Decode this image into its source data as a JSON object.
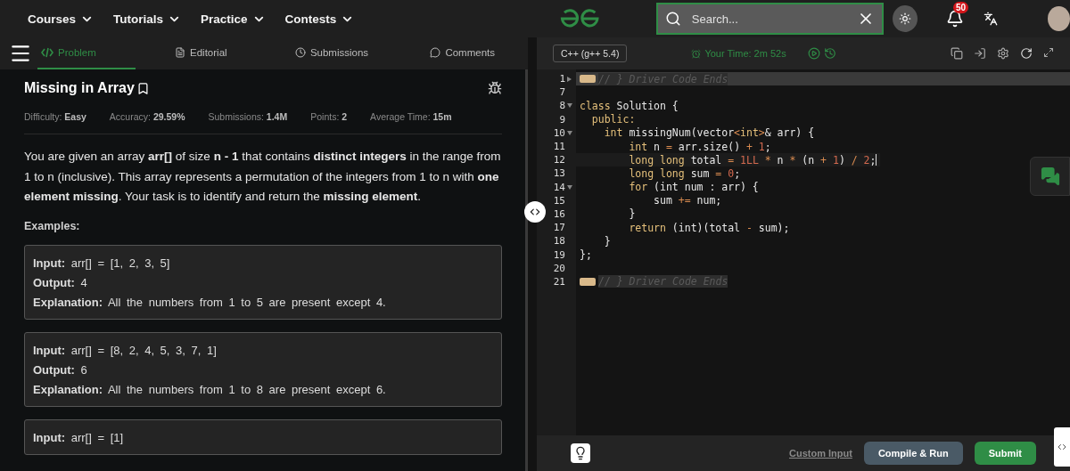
{
  "nav": {
    "menus": [
      "Courses",
      "Tutorials",
      "Practice",
      "Contests"
    ],
    "search": {
      "placeholder": "Search..."
    },
    "notifications": {
      "count": "50"
    }
  },
  "tabs": [
    {
      "label": "Problem",
      "selected": true
    },
    {
      "label": "Editorial",
      "selected": false
    },
    {
      "label": "Submissions",
      "selected": false
    },
    {
      "label": "Comments",
      "selected": false
    }
  ],
  "problem": {
    "title": "Missing in Array",
    "meta": [
      "Difficulty: **Easy**",
      "Accuracy: **29.59%**",
      "Submissions: **1.4M**",
      "Points: **2**",
      "Average Time: **15m**"
    ],
    "description": "You are given an array **arr[]** of size **n - 1** that contains **distinct integers** in the range from 1 to n (inclusive). This array represents a permutation of the integers from 1 to n with **one element missing**. Your task is to identify and return the **missing element**.",
    "examples_label": "Examples:",
    "examples": [
      [
        "**Input:** arr[] = [1, 2, 3, 5]",
        "**Output:** 4",
        "**Explanation:** All the numbers from 1 to 5 are present except 4."
      ],
      [
        "**Input:** arr[] = [8, 2, 4, 5, 3, 7, 1]",
        "**Output:** 6",
        "**Explanation:** All the numbers from 1 to 8 are present except 6."
      ],
      [
        "**Input:** arr[] = [1]"
      ]
    ]
  },
  "editor": {
    "language": "C++ (g++ 5.4)",
    "timer": "Your Time: 2m 52s",
    "lines": [
      {
        "number": "1",
        "kind": "collapsed",
        "highlighted": true,
        "cursor": false,
        "tokens": [
          {
            "kind": "folded",
            "t": "// } Driver Code Ends"
          }
        ]
      },
      {
        "number": "7",
        "kind": "plain",
        "highlighted": false,
        "cursor": false
      },
      {
        "number": "8",
        "kind": "expanded",
        "highlighted": false,
        "cursor": false,
        "tokens": [
          {
            "kind": "keyword",
            "t": "class"
          },
          {
            "kind": "text",
            "t": " Solution {"
          }
        ]
      },
      {
        "number": "9",
        "kind": "plain",
        "highlighted": false,
        "cursor": false,
        "tokens": [
          {
            "kind": "keyword",
            "t": "  public:"
          }
        ]
      },
      {
        "number": "10",
        "kind": "expanded",
        "highlighted": false,
        "cursor": false,
        "tokens": [
          {
            "kind": "keyword",
            "t": "    int"
          },
          {
            "kind": "text",
            "t": " missingNum(vector"
          },
          {
            "kind": "operator",
            "t": "<"
          },
          {
            "kind": "keyword",
            "t": "int"
          },
          {
            "kind": "operator",
            "t": ">"
          },
          {
            "kind": "text",
            "t": "& arr) {"
          }
        ]
      },
      {
        "number": "11",
        "kind": "plain",
        "highlighted": false,
        "cursor": false,
        "tokens": [
          {
            "kind": "keyword",
            "t": "        int"
          },
          {
            "kind": "text",
            "t": " n "
          },
          {
            "kind": "operator",
            "t": "="
          },
          {
            "kind": "text",
            "t": " arr.size() "
          },
          {
            "kind": "operator",
            "t": "+ "
          },
          {
            "kind": "number",
            "t": "1"
          },
          {
            "kind": "text",
            "t": ";"
          }
        ]
      },
      {
        "number": "12",
        "kind": "plain",
        "highlighted": false,
        "cursor": true,
        "tokens": [
          {
            "kind": "keyword",
            "t": "        long long"
          },
          {
            "kind": "text",
            "t": " total "
          },
          {
            "kind": "operator",
            "t": "= "
          },
          {
            "kind": "number",
            "t": "1LL"
          },
          {
            "kind": "operator",
            "t": " *"
          },
          {
            "kind": "text",
            "t": " n "
          },
          {
            "kind": "operator",
            "t": "*"
          },
          {
            "kind": "text",
            "t": " (n "
          },
          {
            "kind": "operator",
            "t": "+ "
          },
          {
            "kind": "number",
            "t": "1"
          },
          {
            "kind": "text",
            "t": ") "
          },
          {
            "kind": "operator",
            "t": "/ "
          },
          {
            "kind": "number",
            "t": "2"
          },
          {
            "kind": "text",
            "t": ";"
          }
        ]
      },
      {
        "number": "13",
        "kind": "plain",
        "highlighted": false,
        "cursor": false,
        "tokens": [
          {
            "kind": "keyword",
            "t": "        long long"
          },
          {
            "kind": "text",
            "t": " sum "
          },
          {
            "kind": "operator",
            "t": "= "
          },
          {
            "kind": "number",
            "t": "0"
          },
          {
            "kind": "text",
            "t": ";"
          }
        ]
      },
      {
        "number": "14",
        "kind": "expanded",
        "highlighted": false,
        "cursor": false,
        "tokens": [
          {
            "kind": "keyword",
            "t": "        for"
          },
          {
            "kind": "text",
            "t": " (int num : arr) {"
          }
        ]
      },
      {
        "number": "15",
        "kind": "plain",
        "highlighted": false,
        "cursor": false,
        "tokens": [
          {
            "kind": "text",
            "t": "            sum "
          },
          {
            "kind": "operator",
            "t": "+="
          },
          {
            "kind": "text",
            "t": " num;"
          }
        ]
      },
      {
        "number": "16",
        "kind": "plain",
        "highlighted": false,
        "cursor": false,
        "tokens": [
          {
            "kind": "text",
            "t": "        }"
          }
        ]
      },
      {
        "number": "17",
        "kind": "plain",
        "highlighted": false,
        "cursor": false,
        "tokens": [
          {
            "kind": "keyword",
            "t": "        return"
          },
          {
            "kind": "text",
            "t": " (int)(total "
          },
          {
            "kind": "operator",
            "t": "-"
          },
          {
            "kind": "text",
            "t": " sum);"
          }
        ]
      },
      {
        "number": "18",
        "kind": "plain",
        "highlighted": false,
        "cursor": false,
        "tokens": [
          {
            "kind": "text",
            "t": "    }"
          }
        ]
      },
      {
        "number": "19",
        "kind": "plain",
        "highlighted": false,
        "cursor": false,
        "tokens": [
          {
            "kind": "text",
            "t": "};"
          }
        ]
      },
      {
        "number": "20",
        "kind": "plain",
        "highlighted": false,
        "cursor": false
      },
      {
        "number": "21",
        "kind": "plain",
        "highlighted": false,
        "cursor": false,
        "tokens": [
          {
            "kind": "folded",
            "t": "// } Driver Code Ends"
          }
        ]
      }
    ],
    "custom_input": "Custom Input",
    "run_label": "Compile & Run",
    "submit_label": "Submit"
  }
}
